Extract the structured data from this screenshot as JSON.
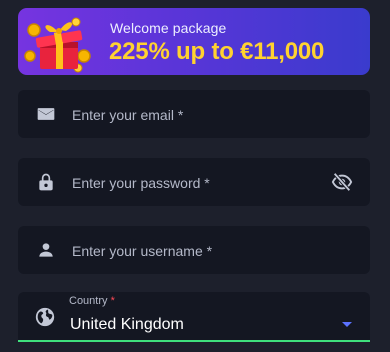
{
  "banner": {
    "subtitle": "Welcome package",
    "headline": "225% up to €11,000",
    "gift_icon": "gift-box-icon"
  },
  "form": {
    "email": {
      "placeholder": "Enter your email *",
      "icon": "mail-icon"
    },
    "password": {
      "placeholder": "Enter your password *",
      "icon": "lock-icon",
      "toggle_icon": "eye-off-icon"
    },
    "username": {
      "placeholder": "Enter your username *",
      "icon": "person-icon"
    },
    "country": {
      "label": "Country",
      "required_mark": "*",
      "value": "United Kingdom",
      "icon": "globe-icon"
    }
  },
  "colors": {
    "background": "#1d202c",
    "field_bg": "#141722",
    "banner_gradient_start": "#7634e0",
    "banner_gradient_end": "#3a3bcd",
    "headline": "#ffd230",
    "focus_underline": "#3fe07d",
    "dropdown_caret": "#5b72ff",
    "required": "#ff4a57"
  }
}
